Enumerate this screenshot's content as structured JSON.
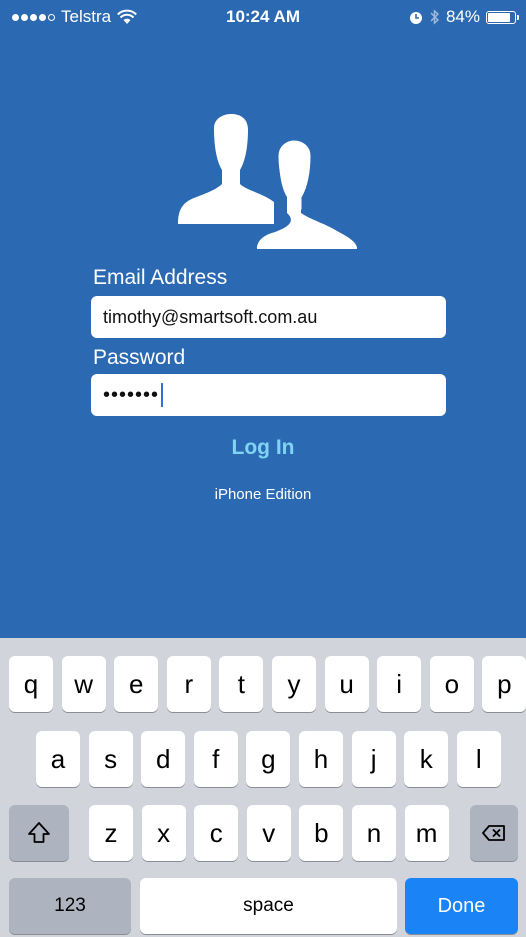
{
  "status_bar": {
    "carrier": "Telstra",
    "time": "10:24 AM",
    "battery": "84%",
    "battery_level": 0.84
  },
  "login": {
    "email_label": "Email Address",
    "email_value": "timothy@smartsoft.com.au",
    "password_label": "Password",
    "password_value": "•••••••",
    "login_button": "Log In",
    "edition": "iPhone Edition",
    "icon": "users-icon",
    "accent_color": "#7fd4f2",
    "background_color": "#2b6ab3"
  },
  "keyboard": {
    "row1": [
      "q",
      "w",
      "e",
      "r",
      "t",
      "y",
      "u",
      "i",
      "o",
      "p"
    ],
    "row2": [
      "a",
      "s",
      "d",
      "f",
      "g",
      "h",
      "j",
      "k",
      "l"
    ],
    "row3": [
      "z",
      "x",
      "c",
      "v",
      "b",
      "n",
      "m"
    ],
    "numbers_key": "123",
    "space_key": "space",
    "done_key": "Done",
    "shift_icon": "shift-icon",
    "delete_icon": "backspace-icon",
    "done_color": "#1a84f6"
  }
}
